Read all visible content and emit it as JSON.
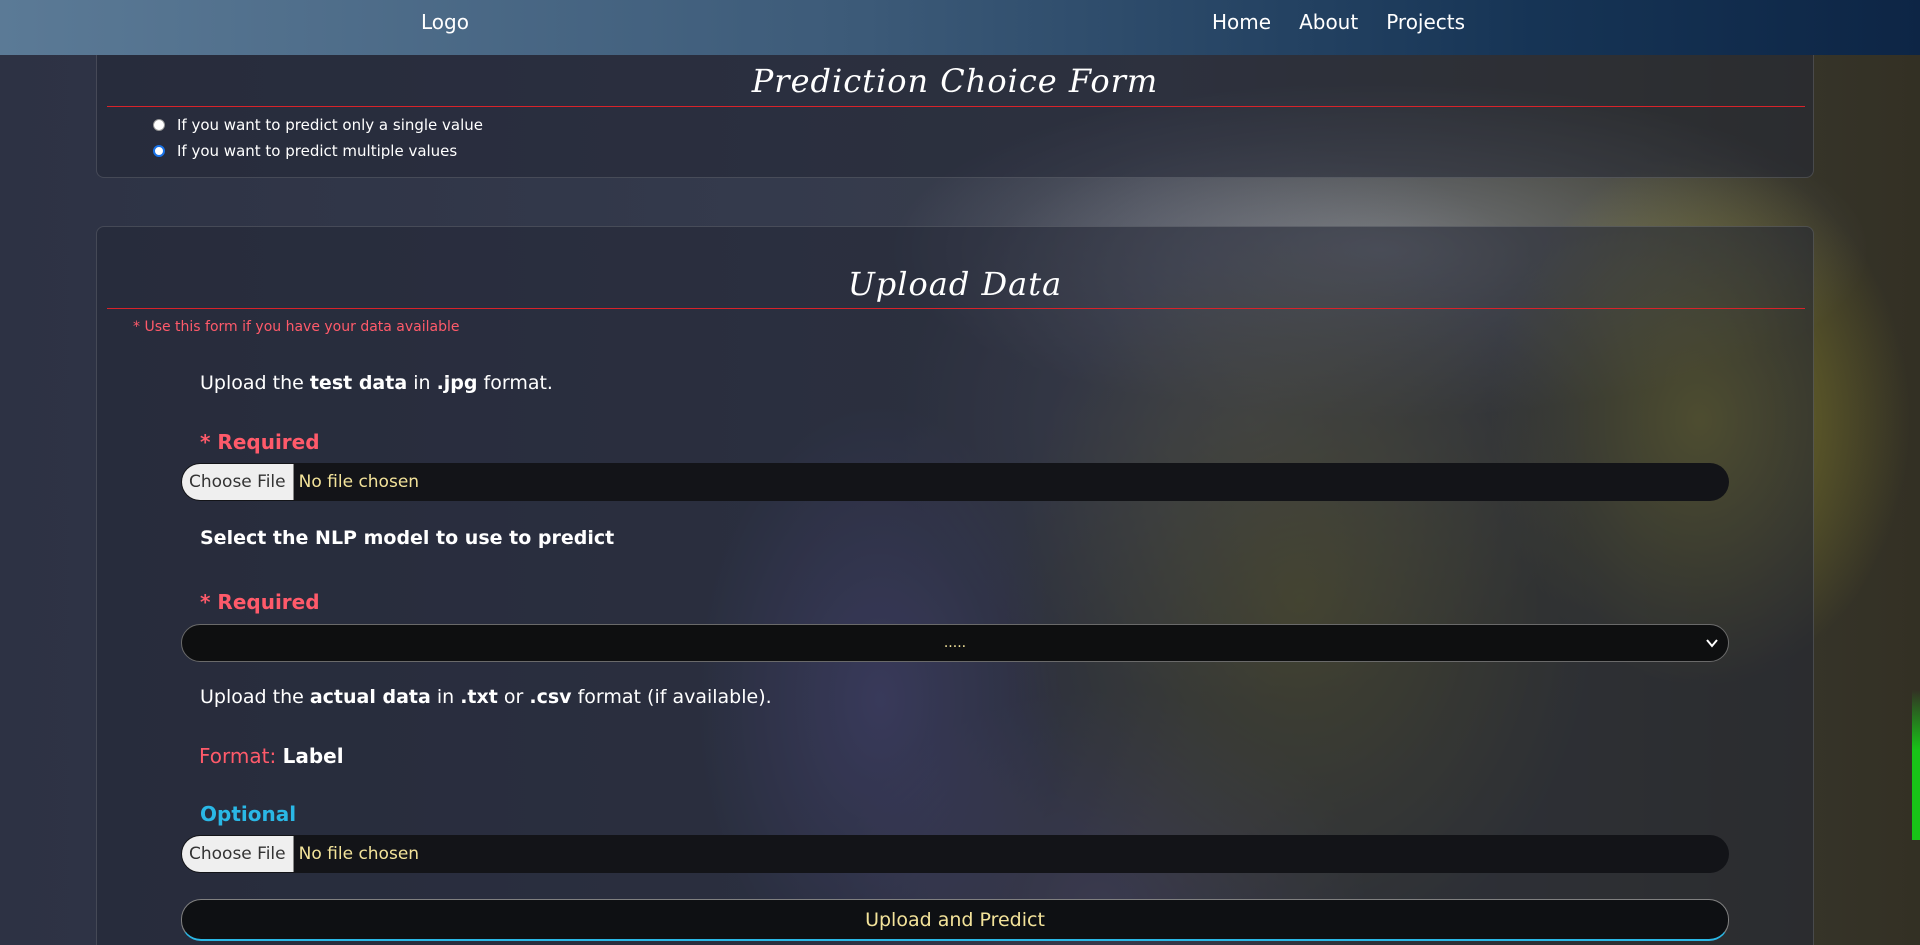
{
  "navbar": {
    "logo": "Logo",
    "links": [
      "Home",
      "About",
      "Projects"
    ]
  },
  "choice_form": {
    "title": "Prediction Choice Form",
    "options": [
      {
        "label": "If you want to predict only a single value",
        "checked": false
      },
      {
        "label": "If you want to predict multiple values",
        "checked": true
      }
    ]
  },
  "upload_form": {
    "title": "Upload Data",
    "note": "* Use this form if you have your data available",
    "test_data": {
      "prefix": "Upload the ",
      "bold1": "test data",
      "mid": " in ",
      "bold2": ".jpg",
      "suffix": " format."
    },
    "required_label": "* Required",
    "file_button": "Choose File",
    "file_status": "No file chosen",
    "model_label": "Select the NLP model to use to predict",
    "model_select_value": ".....",
    "actual_data": {
      "prefix": "Upload the ",
      "bold1": "actual data",
      "mid1": " in ",
      "bold2": ".txt",
      "mid2": " or ",
      "bold3": ".csv",
      "suffix": " format (if available)."
    },
    "format_key": "Format:",
    "format_value": "Label",
    "optional_label": "Optional",
    "submit_label": "Upload and Predict"
  },
  "colors": {
    "accent_red": "#ff5a6a",
    "accent_blue": "#2ab8e6",
    "file_text": "#f3e39a",
    "rule_red": "#d8232a"
  }
}
